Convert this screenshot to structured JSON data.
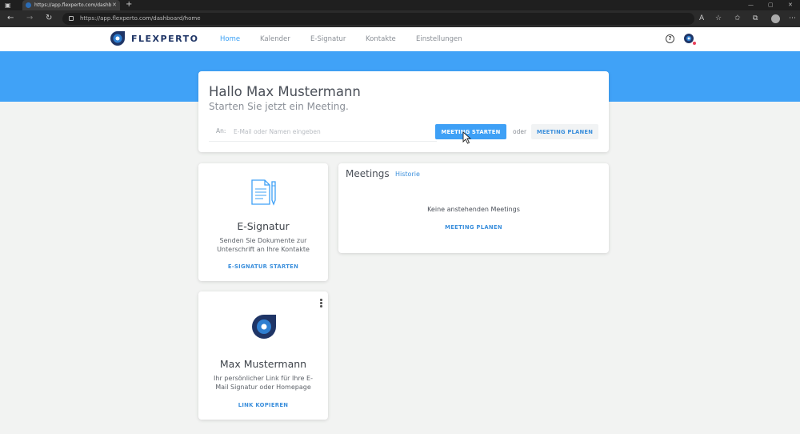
{
  "browser": {
    "tab_title": "https://app.flexperto.com/dashb",
    "tab_close": "✕",
    "new_tab": "+",
    "url": "https://app.flexperto.com/dashboard/home",
    "window_controls": [
      "—",
      "▢",
      "✕"
    ]
  },
  "header": {
    "brand": "FLEXPERTO",
    "nav": [
      {
        "label": "Home",
        "active": true
      },
      {
        "label": "Kalender",
        "active": false
      },
      {
        "label": "E-Signatur",
        "active": false
      },
      {
        "label": "Kontakte",
        "active": false
      },
      {
        "label": "Einstellungen",
        "active": false
      }
    ],
    "help_icon": "?"
  },
  "hero": {
    "greeting": "Hallo Max Mustermann",
    "subtitle": "Starten Sie jetzt ein Meeting.",
    "to_label": "An:",
    "email_placeholder": "E-Mail oder Namen eingeben",
    "start_button": "MEETING STARTEN",
    "or_label": "oder",
    "plan_button": "MEETING PLANEN"
  },
  "esign_card": {
    "icon": "document-pen-icon",
    "title": "E-Signatur",
    "desc_line1": "Senden Sie Dokumente zur",
    "desc_line2": "Unterschrift an Ihre Kontakte",
    "action": "E-SIGNATUR STARTEN"
  },
  "meetings_card": {
    "title": "Meetings",
    "history_link": "Historie",
    "empty_text": "Keine anstehenden Meetings",
    "action": "MEETING PLANEN"
  },
  "profile_card": {
    "icon": "flexperto-logo-icon",
    "name": "Max Mustermann",
    "desc_line1": "Ihr persönlicher Link für Ihre E-",
    "desc_line2": "Mail Signatur oder Homepage",
    "action": "LINK KOPIEREN"
  },
  "colors": {
    "accent": "#3ea0f6",
    "banner": "#40a2f7",
    "brand_navy": "#1f3566",
    "link": "#3b8fdc",
    "background": "#f2f3f2"
  }
}
